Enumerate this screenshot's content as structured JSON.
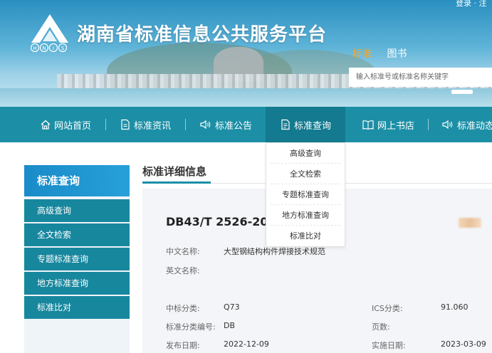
{
  "header": {
    "site_title": "湖南省标准信息公共服务平台",
    "top_links": "登录 · 注",
    "logo_text": "HNIS",
    "search_tabs": [
      "标准",
      "图书"
    ],
    "search_placeholder": "输入标准号或标准名称关键字"
  },
  "nav": {
    "items": [
      {
        "label": "网站首页",
        "icon": "home-icon"
      },
      {
        "label": "标准资讯",
        "icon": "document-icon"
      },
      {
        "label": "标准公告",
        "icon": "speaker-icon"
      },
      {
        "label": "标准查询",
        "icon": "search-document-icon"
      },
      {
        "label": "网上书店",
        "icon": "book-icon"
      },
      {
        "label": "标准动态",
        "icon": "speaker-icon"
      }
    ],
    "active": "标准查询",
    "dropdown": [
      "高级查询",
      "全文检索",
      "专题标准查询",
      "地方标准查询",
      "标准比对"
    ]
  },
  "sidebar": {
    "title": "标准查询",
    "items": [
      "高级查询",
      "全文检索",
      "专题标准查询",
      "地方标准查询",
      "标准比对"
    ]
  },
  "main": {
    "section_title": "标准详细信息",
    "std_number": "DB43/T 2526-2022",
    "fields": {
      "cn_name_label": "中文名称:",
      "cn_name_value": "大型钢结构构件焊接技术规范",
      "en_name_label": "英文名称:",
      "en_name_value": "",
      "ccs_label": "中标分类:",
      "ccs_value": "Q73",
      "ics_label": "ICS分类:",
      "ics_value": "91.060",
      "cat_code_label": "标准分类编号:",
      "cat_code_value": "DB",
      "pages_label": "页数:",
      "pages_value": "",
      "publish_label": "发布日期:",
      "publish_value": "2022-12-09",
      "impl_label": "实施日期:",
      "impl_value": "2023-03-09"
    }
  },
  "colors": {
    "nav_bg": "#1c8fa6",
    "nav_active": "#137a8f",
    "sidebar_head": "#1a8bc9",
    "search_tab_active": "#f4a62a"
  }
}
